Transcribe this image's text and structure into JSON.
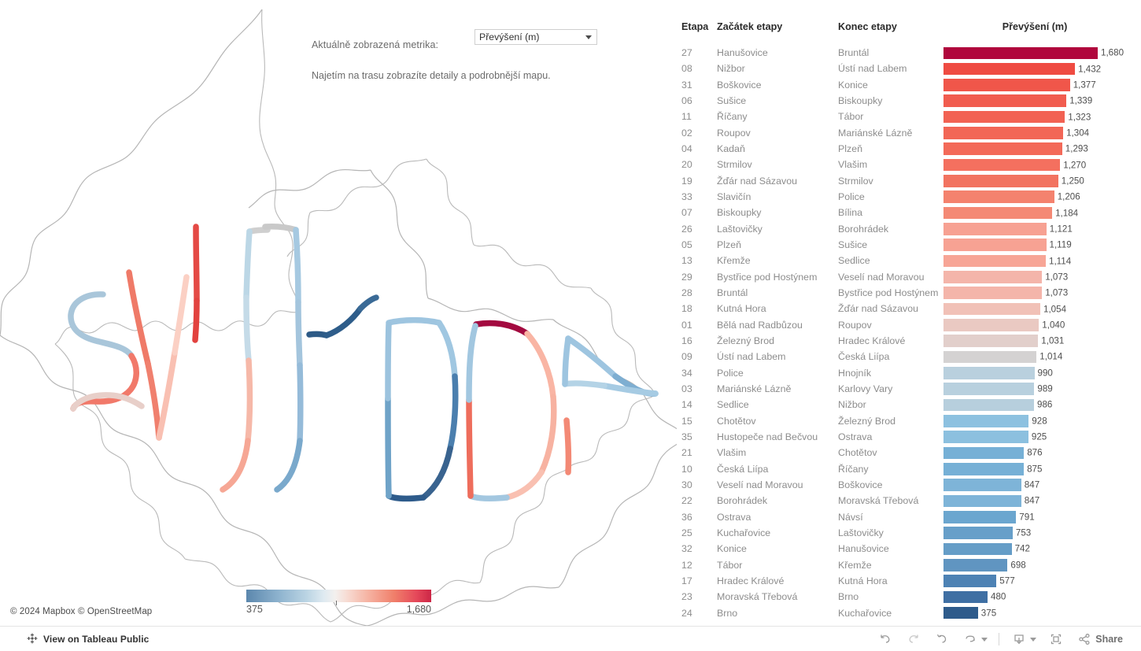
{
  "controls": {
    "metric_label": "Aktuálně zobrazená metrika:",
    "metric_selected": "Převýšení (m)",
    "metric_options": [
      "Převýšení (m)"
    ],
    "hint": "Najetím na trasu zobrazíte detaily a podrobnější mapu."
  },
  "legend": {
    "min": "375",
    "max": "1,680",
    "low_color": "#5b87ad",
    "mid_color": "#f1efee",
    "high_color": "#cc2646"
  },
  "map": {
    "attribution": "© 2024 Mapbox  © OpenStreetMap"
  },
  "table": {
    "headers": {
      "etapa": "Etapa",
      "start": "Začátek etapy",
      "end": "Konec etapy",
      "metric": "Převýšení (m)"
    }
  },
  "toolbar": {
    "view_on_tableau": "View on Tableau Public",
    "share_label": "Share",
    "undo": "Undo",
    "redo": "Redo",
    "revert": "Revert",
    "refresh": "Refresh",
    "download": "Download",
    "fullscreen": "Full Screen"
  },
  "chart_data": {
    "type": "bar",
    "title": "Převýšení (m)",
    "xlabel": "",
    "ylabel": "",
    "orientation": "horizontal",
    "sorted": "descending",
    "xlim": [
      0,
      1680
    ],
    "grid": false,
    "legend": "gradient colorbar, 375 to 1,680",
    "colormap": "blue-white-red diverging",
    "categories": [
      "27 Hanušovice → Bruntál",
      "08 Nižbor → Ústí nad Labem",
      "31 Boškovice → Konice",
      "06 Sušice → Biskoupky",
      "11 Říčany → Tábor",
      "02 Roupov → Mariánské Lázně",
      "04 Kadaň → Plzeň",
      "20 Strmilov → Vlašim",
      "19 Žďár nad Sázavou → Strmilov",
      "33 Slavičín → Police",
      "07 Biskoupky → Bílina",
      "26 Laštovičky → Borohrádek",
      "05 Plzeň → Sušice",
      "13 Křemže → Sedlice",
      "29 Bystřice pod Hostýnem → Veselí nad Moravou",
      "28 Bruntál → Bystřice pod Hostýnem",
      "18 Kutná Hora → Žďár nad Sázavou",
      "01 Bělá nad Radbůzou → Roupov",
      "16 Železný Brod → Hradec Králové",
      "09 Ústí nad Labem → Česká Liípa",
      "34 Police → Hnojník",
      "03 Mariánské Lázně → Karlovy Vary",
      "14 Sedlice → Nižbor",
      "15 Chotětov → Železný Brod",
      "35 Hustopeče nad Bečvou → Ostrava",
      "21 Vlašim → Chotětov",
      "10 Česká Liípa → Říčany",
      "30 Veselí nad Moravou → Boškovice",
      "22 Borohrádek → Moravská Třebová",
      "36 Ostrava → Návsí",
      "25 Kuchařovice → Laštovičky",
      "32 Konice → Hanušovice",
      "12 Tábor → Křemže",
      "17 Hradec Králové → Kutná Hora",
      "23 Moravská Třebová → Brno",
      "24 Brno → Kuchařovice"
    ],
    "values": [
      1680,
      1432,
      1377,
      1339,
      1323,
      1304,
      1293,
      1270,
      1250,
      1206,
      1184,
      1121,
      1119,
      1114,
      1073,
      1073,
      1054,
      1040,
      1031,
      1014,
      990,
      989,
      986,
      928,
      925,
      876,
      875,
      847,
      847,
      791,
      753,
      742,
      698,
      577,
      480,
      375
    ]
  },
  "rows": [
    {
      "etapa": "27",
      "start": "Hanušovice",
      "end": "Bruntál",
      "value": 1680,
      "value_label": "1,680",
      "color": "#b0063c"
    },
    {
      "etapa": "08",
      "start": "Nižbor",
      "end": "Ústí nad Labem",
      "value": 1432,
      "value_label": "1,432",
      "color": "#ef4b42"
    },
    {
      "etapa": "31",
      "start": "Boškovice",
      "end": "Konice",
      "value": 1377,
      "value_label": "1,377",
      "color": "#f0564a"
    },
    {
      "etapa": "06",
      "start": "Sušice",
      "end": "Biskoupky",
      "value": 1339,
      "value_label": "1,339",
      "color": "#f15c4f"
    },
    {
      "etapa": "11",
      "start": "Říčany",
      "end": "Tábor",
      "value": 1323,
      "value_label": "1,323",
      "color": "#f26253"
    },
    {
      "etapa": "02",
      "start": "Roupov",
      "end": "Mariánské Lázně",
      "value": 1304,
      "value_label": "1,304",
      "color": "#f26656"
    },
    {
      "etapa": "04",
      "start": "Kadaň",
      "end": "Plzeň",
      "value": 1293,
      "value_label": "1,293",
      "color": "#f36a59"
    },
    {
      "etapa": "20",
      "start": "Strmilov",
      "end": "Vlašim",
      "value": 1270,
      "value_label": "1,270",
      "color": "#f4705f"
    },
    {
      "etapa": "19",
      "start": "Žďár nad Sázavou",
      "end": "Strmilov",
      "value": 1250,
      "value_label": "1,250",
      "color": "#f27360"
    },
    {
      "etapa": "33",
      "start": "Slavičín",
      "end": "Police",
      "value": 1206,
      "value_label": "1,206",
      "color": "#f4826e"
    },
    {
      "etapa": "07",
      "start": "Biskoupky",
      "end": "Bílina",
      "value": 1184,
      "value_label": "1,184",
      "color": "#f48975"
    },
    {
      "etapa": "26",
      "start": "Laštovičky",
      "end": "Borohrádek",
      "value": 1121,
      "value_label": "1,121",
      "color": "#f7a192"
    },
    {
      "etapa": "05",
      "start": "Plzeň",
      "end": "Sušice",
      "value": 1119,
      "value_label": "1,119",
      "color": "#f7a293"
    },
    {
      "etapa": "13",
      "start": "Křemže",
      "end": "Sedlice",
      "value": 1114,
      "value_label": "1,114",
      "color": "#f7a596"
    },
    {
      "etapa": "29",
      "start": "Bystřice pod Hostýnem",
      "end": "Veselí nad Moravou",
      "value": 1073,
      "value_label": "1,073",
      "color": "#f4b5aa"
    },
    {
      "etapa": "28",
      "start": "Bruntál",
      "end": "Bystřice pod Hostýnem",
      "value": 1073,
      "value_label": "1,073",
      "color": "#f4b5aa"
    },
    {
      "etapa": "18",
      "start": "Kutná Hora",
      "end": "Žďár nad Sázavou",
      "value": 1054,
      "value_label": "1,054",
      "color": "#f1c1b7"
    },
    {
      "etapa": "01",
      "start": "Bělá nad Radbůzou",
      "end": "Roupov",
      "value": 1040,
      "value_label": "1,040",
      "color": "#eac9c2"
    },
    {
      "etapa": "16",
      "start": "Železný Brod",
      "end": "Hradec Králové",
      "value": 1031,
      "value_label": "1,031",
      "color": "#e2cfcb"
    },
    {
      "etapa": "09",
      "start": "Ústí nad Labem",
      "end": "Česká Liípa",
      "value": 1014,
      "value_label": "1,014",
      "color": "#d4d2d2"
    },
    {
      "etapa": "34",
      "start": "Police",
      "end": "Hnojník",
      "value": 990,
      "value_label": "990",
      "color": "#b9d0de"
    },
    {
      "etapa": "03",
      "start": "Mariánské Lázně",
      "end": "Karlovy Vary",
      "value": 989,
      "value_label": "989",
      "color": "#b8d0de"
    },
    {
      "etapa": "14",
      "start": "Sedlice",
      "end": "Nižbor",
      "value": 986,
      "value_label": "986",
      "color": "#b7cfdd"
    },
    {
      "etapa": "15",
      "start": "Chotětov",
      "end": "Železný Brod",
      "value": 928,
      "value_label": "928",
      "color": "#8dc1e0"
    },
    {
      "etapa": "35",
      "start": "Hustopeče nad Bečvou",
      "end": "Ostrava",
      "value": 925,
      "value_label": "925",
      "color": "#8cc0df"
    },
    {
      "etapa": "21",
      "start": "Vlašim",
      "end": "Chotětov",
      "value": 876,
      "value_label": "876",
      "color": "#76b0d6"
    },
    {
      "etapa": "10",
      "start": "Česká Liípa",
      "end": "Říčany",
      "value": 875,
      "value_label": "875",
      "color": "#76b0d6"
    },
    {
      "etapa": "30",
      "start": "Veselí nad Moravou",
      "end": "Boškovice",
      "value": 847,
      "value_label": "847",
      "color": "#7eb4d8"
    },
    {
      "etapa": "22",
      "start": "Borohrádek",
      "end": "Moravská Třebová",
      "value": 847,
      "value_label": "847",
      "color": "#7eb4d8"
    },
    {
      "etapa": "36",
      "start": "Ostrava",
      "end": "Návsí",
      "value": 791,
      "value_label": "791",
      "color": "#6ba6cf"
    },
    {
      "etapa": "25",
      "start": "Kuchařovice",
      "end": "Laštovičky",
      "value": 753,
      "value_label": "753",
      "color": "#679fc9"
    },
    {
      "etapa": "32",
      "start": "Konice",
      "end": "Hanušovice",
      "value": 742,
      "value_label": "742",
      "color": "#659dc7"
    },
    {
      "etapa": "12",
      "start": "Tábor",
      "end": "Křemže",
      "value": 698,
      "value_label": "698",
      "color": "#6095c1"
    },
    {
      "etapa": "17",
      "start": "Hradec Králové",
      "end": "Kutná Hora",
      "value": 577,
      "value_label": "577",
      "color": "#4d82b4"
    },
    {
      "etapa": "23",
      "start": "Moravská Třebová",
      "end": "Brno",
      "value": 480,
      "value_label": "480",
      "color": "#3f6fa3"
    },
    {
      "etapa": "24",
      "start": "Brno",
      "end": "Kuchařovice",
      "value": 375,
      "value_label": "375",
      "color": "#2e5b8b"
    }
  ]
}
